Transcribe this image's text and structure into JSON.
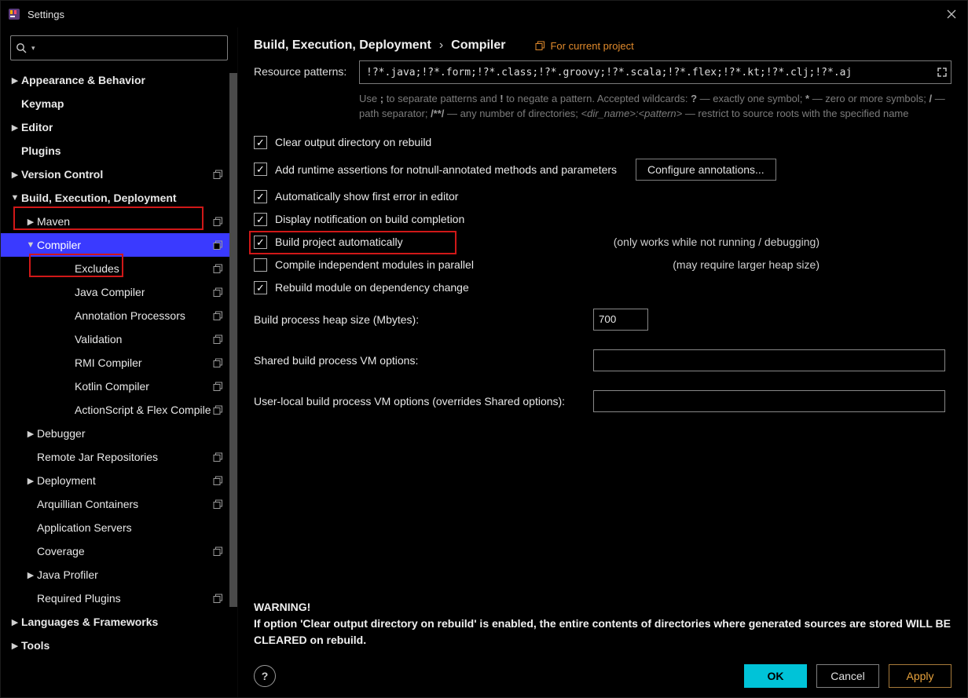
{
  "window": {
    "title": "Settings"
  },
  "sidebar": {
    "search_placeholder": "",
    "items": [
      {
        "label": "Appearance & Behavior",
        "level": 0,
        "bold": true,
        "arrow": "right",
        "badge": false
      },
      {
        "label": "Keymap",
        "level": 0,
        "bold": true,
        "arrow": "",
        "badge": false
      },
      {
        "label": "Editor",
        "level": 0,
        "bold": true,
        "arrow": "right",
        "badge": false
      },
      {
        "label": "Plugins",
        "level": 0,
        "bold": true,
        "arrow": "",
        "badge": false
      },
      {
        "label": "Version Control",
        "level": 0,
        "bold": true,
        "arrow": "right",
        "badge": true
      },
      {
        "label": "Build, Execution, Deployment",
        "level": 0,
        "bold": true,
        "arrow": "down",
        "badge": false
      },
      {
        "label": "Maven",
        "level": 1,
        "bold": false,
        "arrow": "right",
        "badge": true
      },
      {
        "label": "Compiler",
        "level": 1,
        "bold": false,
        "arrow": "down",
        "badge": true,
        "selected": true
      },
      {
        "label": "Excludes",
        "level": 2,
        "bold": false,
        "arrow": "",
        "badge": true
      },
      {
        "label": "Java Compiler",
        "level": 2,
        "bold": false,
        "arrow": "",
        "badge": true
      },
      {
        "label": "Annotation Processors",
        "level": 2,
        "bold": false,
        "arrow": "",
        "badge": true
      },
      {
        "label": "Validation",
        "level": 2,
        "bold": false,
        "arrow": "",
        "badge": true
      },
      {
        "label": "RMI Compiler",
        "level": 2,
        "bold": false,
        "arrow": "",
        "badge": true
      },
      {
        "label": "Kotlin Compiler",
        "level": 2,
        "bold": false,
        "arrow": "",
        "badge": true
      },
      {
        "label": "ActionScript & Flex Compile",
        "level": 2,
        "bold": false,
        "arrow": "",
        "badge": true
      },
      {
        "label": "Debugger",
        "level": 1,
        "bold": false,
        "arrow": "right",
        "badge": false
      },
      {
        "label": "Remote Jar Repositories",
        "level": 1,
        "bold": false,
        "arrow": "",
        "badge": true
      },
      {
        "label": "Deployment",
        "level": 1,
        "bold": false,
        "arrow": "right",
        "badge": true
      },
      {
        "label": "Arquillian Containers",
        "level": 1,
        "bold": false,
        "arrow": "",
        "badge": true
      },
      {
        "label": "Application Servers",
        "level": 1,
        "bold": false,
        "arrow": "",
        "badge": false
      },
      {
        "label": "Coverage",
        "level": 1,
        "bold": false,
        "arrow": "",
        "badge": true
      },
      {
        "label": "Java Profiler",
        "level": 1,
        "bold": false,
        "arrow": "right",
        "badge": false
      },
      {
        "label": "Required Plugins",
        "level": 1,
        "bold": false,
        "arrow": "",
        "badge": true
      },
      {
        "label": "Languages & Frameworks",
        "level": 0,
        "bold": true,
        "arrow": "right",
        "badge": false
      },
      {
        "label": "Tools",
        "level": 0,
        "bold": true,
        "arrow": "right",
        "badge": false
      }
    ]
  },
  "breadcrumb": {
    "parent": "Build, Execution, Deployment",
    "current": "Compiler",
    "project_hint": "For current project"
  },
  "resource": {
    "label": "Resource patterns:",
    "value": "!?*.java;!?*.form;!?*.class;!?*.groovy;!?*.scala;!?*.flex;!?*.kt;!?*.clj;!?*.aj",
    "hint_prefix": "Use ",
    "hint_semi": ";",
    "hint_mid1": " to separate patterns and ",
    "hint_bang": "!",
    "hint_mid2": " to negate a pattern. Accepted wildcards: ",
    "hint_q": "?",
    "hint_mid3": " — exactly one symbol; ",
    "hint_star": "*",
    "hint_mid4": " — zero or more symbols; ",
    "hint_slash": "/",
    "hint_mid5": " — path separator; ",
    "hint_dstar": "/**/",
    "hint_mid6": " — any number of directories; ",
    "hint_dir": "<dir_name>:<pattern>",
    "hint_mid7": " — restrict to source roots with the specified name"
  },
  "checks": {
    "clear_output": {
      "label": "Clear output directory on rebuild",
      "checked": true
    },
    "add_runtime": {
      "label": "Add runtime assertions for notnull-annotated methods and parameters",
      "checked": true
    },
    "configure_btn": "Configure annotations...",
    "auto_first_err": {
      "label": "Automatically show first error in editor",
      "checked": true
    },
    "notify_build": {
      "label": "Display notification on build completion",
      "checked": true
    },
    "build_auto": {
      "label": "Build project automatically",
      "checked": true,
      "side": "(only works while not running / debugging)"
    },
    "compile_par": {
      "label": "Compile independent modules in parallel",
      "checked": false,
      "side": "(may require larger heap size)"
    },
    "rebuild_dep": {
      "label": "Rebuild module on dependency change",
      "checked": true
    }
  },
  "form": {
    "heap_label": "Build process heap size (Mbytes):",
    "heap_value": "700",
    "shared_label": "Shared build process VM options:",
    "shared_value": "",
    "user_label": "User-local build process VM options (overrides Shared options):",
    "user_value": ""
  },
  "warning": {
    "title": "WARNING!",
    "body": "If option 'Clear output directory on rebuild' is enabled, the entire contents of directories where generated sources are stored WILL BE CLEARED on rebuild."
  },
  "footer": {
    "ok": "OK",
    "cancel": "Cancel",
    "apply": "Apply"
  }
}
